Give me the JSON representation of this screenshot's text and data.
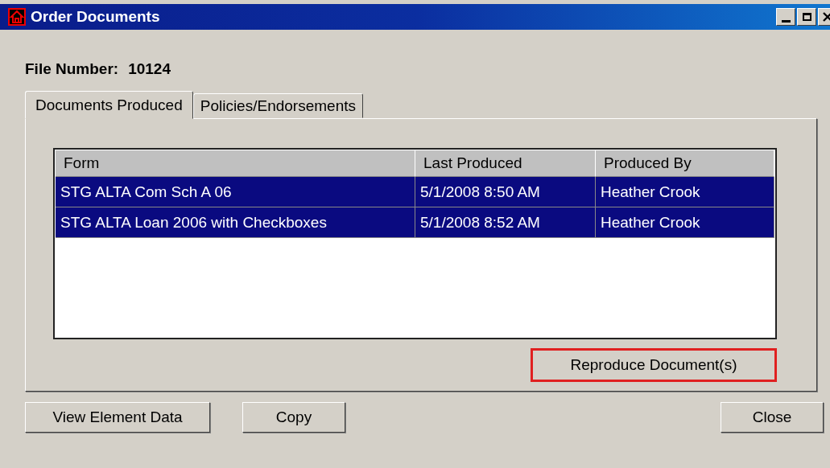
{
  "window": {
    "title": "Order Documents",
    "controls": [
      {
        "kind": "minimize"
      },
      {
        "kind": "maximize"
      },
      {
        "kind": "close"
      }
    ]
  },
  "file_number": {
    "label": "File Number:",
    "value": "10124"
  },
  "tabs": [
    {
      "label": "Documents Produced",
      "selected": true
    },
    {
      "label": "Policies/Endorsements",
      "selected": false
    }
  ],
  "table": {
    "columns": [
      "Form",
      "Last Produced",
      "Produced By"
    ],
    "rows": [
      {
        "cells": [
          "STG ALTA Com Sch A 06",
          "5/1/2008 8:50 AM",
          "Heather Crook"
        ],
        "selected": true
      },
      {
        "cells": [
          "STG ALTA Loan 2006 with Checkboxes",
          "5/1/2008 8:52 AM",
          "Heather Crook"
        ],
        "selected": true
      }
    ]
  },
  "reproduce_button": {
    "label": "Reproduce Document(s)",
    "highlighted": true
  },
  "buttons": [
    "View Element Data",
    "Copy",
    "Close"
  ]
}
